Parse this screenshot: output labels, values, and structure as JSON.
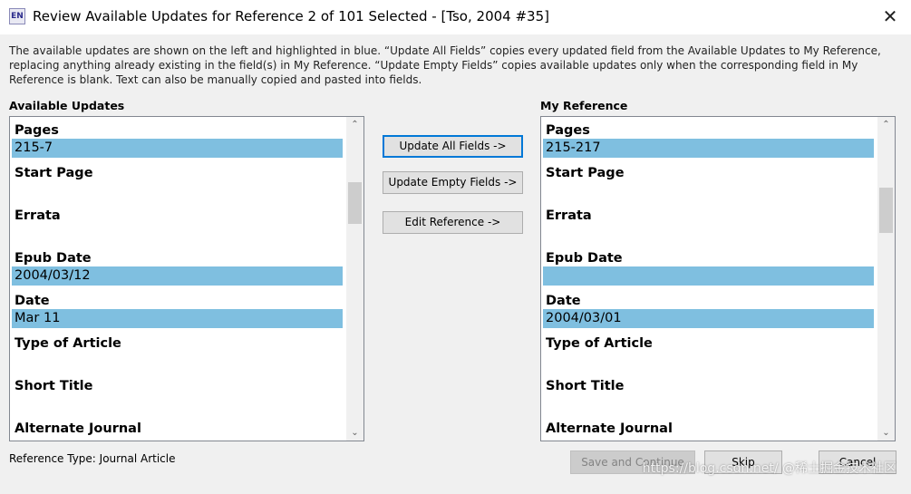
{
  "window": {
    "icon_text": "EN",
    "title": "Review Available Updates for Reference 2 of 101 Selected - [Tso, 2004 #35]",
    "close_glyph": "✕"
  },
  "description": "The available updates are shown on the left and highlighted in blue. “Update All Fields” copies every updated field from the Available Updates to My Reference, replacing anything already existing in the field(s) in My Reference. “Update Empty Fields” copies available updates only when the corresponding field in My Reference is blank. Text can also be manually copied and pasted into fields.",
  "available": {
    "label": "Available Updates",
    "fields": [
      {
        "name": "Pages",
        "value": "215-7",
        "highlight": true
      },
      {
        "name": "Start Page",
        "value": "",
        "highlight": false
      },
      {
        "name": "Errata",
        "value": "",
        "highlight": false
      },
      {
        "name": "Epub Date",
        "value": "2004/03/12",
        "highlight": true
      },
      {
        "name": "Date",
        "value": "Mar 11",
        "highlight": true
      },
      {
        "name": "Type of Article",
        "value": "",
        "highlight": false
      },
      {
        "name": "Short Title",
        "value": "",
        "highlight": false
      },
      {
        "name": "Alternate Journal",
        "value": "",
        "highlight": false
      }
    ]
  },
  "mine": {
    "label": "My Reference",
    "fields": [
      {
        "name": "Pages",
        "value": "215-217",
        "highlight": true
      },
      {
        "name": "Start Page",
        "value": "",
        "highlight": false
      },
      {
        "name": "Errata",
        "value": "",
        "highlight": false
      },
      {
        "name": "Epub Date",
        "value": "",
        "highlight": true
      },
      {
        "name": "Date",
        "value": "2004/03/01",
        "highlight": true
      },
      {
        "name": "Type of Article",
        "value": "",
        "highlight": false
      },
      {
        "name": "Short Title",
        "value": "",
        "highlight": false
      },
      {
        "name": "Alternate Journal",
        "value": "",
        "highlight": false
      }
    ]
  },
  "actions": {
    "update_all": "Update All Fields ->",
    "update_empty": "Update Empty Fields ->",
    "edit_reference": "Edit Reference ->"
  },
  "footer": {
    "reference_type": "Reference Type: Journal Article",
    "save_continue": "Save and Continue",
    "skip": "Skip",
    "cancel": "Cancel"
  },
  "watermark": "https://blog.csdn.net/ @稀土掘金技术社区",
  "colors": {
    "highlight": "#7fbfe0",
    "default_button_border": "#0078d7"
  },
  "icons": {
    "scroll_up": "⌃",
    "scroll_down": "⌄"
  }
}
